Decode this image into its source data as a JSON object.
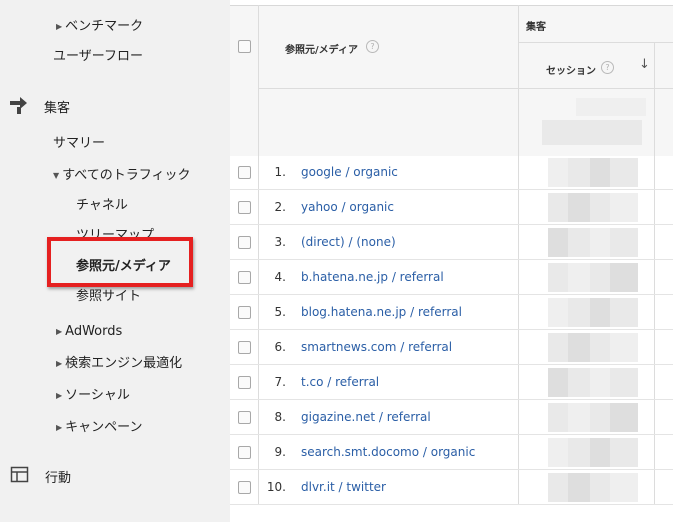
{
  "sidebar": {
    "benchmark": "ベンチマーク",
    "user_flow": "ユーザーフロー",
    "acquisition": "集客",
    "summary": "サマリー",
    "all_traffic": "すべてのトラフィック",
    "channels": "チャネル",
    "treemaps": "ツリーマップ",
    "source_medium": "参照元/メディア",
    "referrals": "参照サイト",
    "adwords": "AdWords",
    "seo": "検索エンジン最適化",
    "social": "ソーシャル",
    "campaigns": "キャンペーン",
    "behavior": "行動"
  },
  "table": {
    "dimension_header": "参照元/メディア",
    "group_header": "集客",
    "sessions_header": "セッション",
    "help_glyph": "?",
    "sort_glyph": "↓",
    "rows": [
      {
        "num": "1.",
        "source": "google / organic"
      },
      {
        "num": "2.",
        "source": "yahoo / organic"
      },
      {
        "num": "3.",
        "source": "(direct) / (none)"
      },
      {
        "num": "4.",
        "source": "b.hatena.ne.jp / referral"
      },
      {
        "num": "5.",
        "source": "blog.hatena.ne.jp / referral"
      },
      {
        "num": "6.",
        "source": "smartnews.com / referral"
      },
      {
        "num": "7.",
        "source": "t.co / referral"
      },
      {
        "num": "8.",
        "source": "gigazine.net / referral"
      },
      {
        "num": "9.",
        "source": "search.smt.docomo / organic"
      },
      {
        "num": "10.",
        "source": "dlvr.it / twitter"
      }
    ]
  },
  "colors": {
    "sidebar_bg": "#f1f1f1",
    "link": "#2a5ea6",
    "highlight": "#e52020"
  },
  "icons": {
    "acquisition": "acquisition-arrows-icon",
    "behavior": "behavior-layout-icon"
  }
}
